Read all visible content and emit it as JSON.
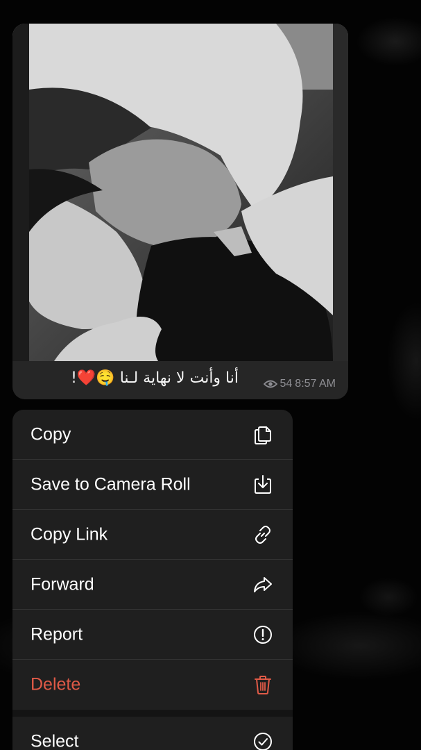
{
  "message": {
    "caption": "أنا وأنت لا نهاية لـنا 🤤❤️!",
    "views": "54",
    "time": "8:57 AM",
    "photo_icon": "photo-couple-bw"
  },
  "menu": {
    "items": [
      {
        "label": "Copy",
        "icon": "copy-icon",
        "color": "#ffffff"
      },
      {
        "label": "Save to Camera Roll",
        "icon": "save-download-icon",
        "color": "#ffffff"
      },
      {
        "label": "Copy Link",
        "icon": "link-icon",
        "color": "#ffffff"
      },
      {
        "label": "Forward",
        "icon": "forward-arrow-icon",
        "color": "#ffffff"
      },
      {
        "label": "Report",
        "icon": "exclamation-circle-icon",
        "color": "#ffffff"
      },
      {
        "label": "Delete",
        "icon": "trash-icon",
        "color": "#e05a47"
      },
      {
        "label": "Select",
        "icon": "check-circle-icon",
        "color": "#ffffff"
      }
    ]
  },
  "colors": {
    "background": "#000000",
    "bubble": "#262626",
    "menu": "#1f1f1f",
    "destructive": "#e05a47",
    "meta": "#8e8e93"
  }
}
